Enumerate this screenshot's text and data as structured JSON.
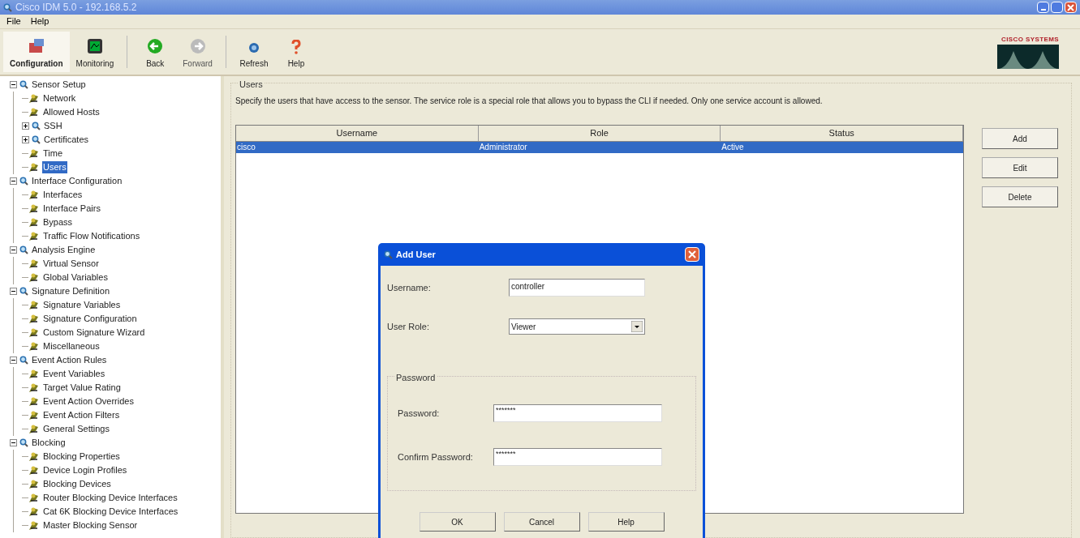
{
  "window": {
    "title": "Cisco IDM 5.0 - 192.168.5.2"
  },
  "menu": [
    "File",
    "Help"
  ],
  "toolbar": [
    {
      "label": "Configuration",
      "kind": "config",
      "selected": true,
      "disabled": false
    },
    {
      "label": "Monitoring",
      "kind": "monitor",
      "selected": false,
      "disabled": false
    },
    {
      "label": "Back",
      "kind": "back",
      "selected": false,
      "disabled": false
    },
    {
      "label": "Forward",
      "kind": "forward",
      "selected": false,
      "disabled": true
    },
    {
      "label": "Refresh",
      "kind": "refresh",
      "selected": false,
      "disabled": false
    },
    {
      "label": "Help",
      "kind": "help",
      "selected": false,
      "disabled": false
    }
  ],
  "logo": {
    "text": "CISCO SYSTEMS"
  },
  "tree": [
    {
      "label": "Sensor Setup",
      "kind": "folder",
      "expanded": true,
      "selected": false,
      "children": [
        {
          "label": "Network",
          "kind": "leaf",
          "selected": false
        },
        {
          "label": "Allowed Hosts",
          "kind": "leaf",
          "selected": false
        },
        {
          "label": "SSH",
          "kind": "folder",
          "expanded": false,
          "selected": false
        },
        {
          "label": "Certificates",
          "kind": "folder",
          "expanded": false,
          "selected": false
        },
        {
          "label": "Time",
          "kind": "leaf",
          "selected": false
        },
        {
          "label": "Users",
          "kind": "leaf",
          "selected": true
        }
      ]
    },
    {
      "label": "Interface Configuration",
      "kind": "folder",
      "expanded": true,
      "selected": false,
      "children": [
        {
          "label": "Interfaces",
          "kind": "leaf",
          "selected": false
        },
        {
          "label": "Interface Pairs",
          "kind": "leaf",
          "selected": false
        },
        {
          "label": "Bypass",
          "kind": "leaf",
          "selected": false
        },
        {
          "label": "Traffic Flow Notifications",
          "kind": "leaf",
          "selected": false
        }
      ]
    },
    {
      "label": "Analysis Engine",
      "kind": "folder",
      "expanded": true,
      "selected": false,
      "children": [
        {
          "label": "Virtual Sensor",
          "kind": "leaf",
          "selected": false
        },
        {
          "label": "Global Variables",
          "kind": "leaf",
          "selected": false
        }
      ]
    },
    {
      "label": "Signature Definition",
      "kind": "folder",
      "expanded": true,
      "selected": false,
      "children": [
        {
          "label": "Signature Variables",
          "kind": "leaf",
          "selected": false
        },
        {
          "label": "Signature Configuration",
          "kind": "leaf",
          "selected": false
        },
        {
          "label": "Custom Signature Wizard",
          "kind": "leaf",
          "selected": false
        },
        {
          "label": "Miscellaneous",
          "kind": "leaf",
          "selected": false
        }
      ]
    },
    {
      "label": "Event Action Rules",
      "kind": "folder",
      "expanded": true,
      "selected": false,
      "children": [
        {
          "label": "Event Variables",
          "kind": "leaf",
          "selected": false
        },
        {
          "label": "Target Value Rating",
          "kind": "leaf",
          "selected": false
        },
        {
          "label": "Event Action Overrides",
          "kind": "leaf",
          "selected": false
        },
        {
          "label": "Event Action Filters",
          "kind": "leaf",
          "selected": false
        },
        {
          "label": "General Settings",
          "kind": "leaf",
          "selected": false
        }
      ]
    },
    {
      "label": "Blocking",
      "kind": "folder",
      "expanded": true,
      "selected": false,
      "children": [
        {
          "label": "Blocking Properties",
          "kind": "leaf",
          "selected": false
        },
        {
          "label": "Device Login Profiles",
          "kind": "leaf",
          "selected": false
        },
        {
          "label": "Blocking Devices",
          "kind": "leaf",
          "selected": false
        },
        {
          "label": "Router Blocking Device Interfaces",
          "kind": "leaf",
          "selected": false
        },
        {
          "label": "Cat 6K Blocking Device Interfaces",
          "kind": "leaf",
          "selected": false
        },
        {
          "label": "Master Blocking Sensor",
          "kind": "leaf",
          "selected": false
        }
      ]
    }
  ],
  "panel": {
    "title": "Users",
    "description": "Specify the users that have access to the sensor.  The service role is a special role that allows you to bypass the CLI if needed.  Only one service account is allowed.",
    "table": {
      "columns": [
        "Username",
        "Role",
        "Status"
      ],
      "rows": [
        {
          "cells": [
            "cisco",
            "Administrator",
            "Active"
          ],
          "selected": true
        }
      ]
    },
    "buttons": [
      "Add",
      "Edit",
      "Delete"
    ]
  },
  "dialog": {
    "title": "Add User",
    "username_label": "Username:",
    "username": "controller",
    "role_label": "User Role:",
    "role": "Viewer",
    "group_title": "Password",
    "password_label": "Password:",
    "password": "*******",
    "confirm_label": "Confirm Password:",
    "confirm": "*******",
    "buttons": [
      "OK",
      "Cancel",
      "Help"
    ]
  }
}
